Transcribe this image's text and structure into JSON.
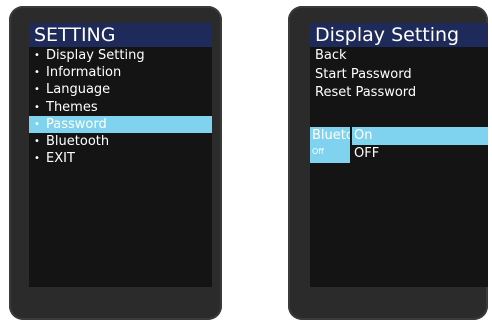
{
  "left_screen": {
    "title": "SETTING",
    "items": [
      {
        "label": "Display Setting"
      },
      {
        "label": "Information"
      },
      {
        "label": "Language"
      },
      {
        "label": "Themes"
      },
      {
        "label": "Password"
      },
      {
        "label": "Bluetooth"
      },
      {
        "label": "EXIT"
      }
    ],
    "selected_index": 4,
    "bullet": "•"
  },
  "right_screen": {
    "title": "Display Setting",
    "items": [
      {
        "label": "Back"
      },
      {
        "label": "Start Password"
      },
      {
        "label": "Reset Password"
      }
    ],
    "bluetooth": {
      "label": "Blueto",
      "state": "Off",
      "options": [
        {
          "label": "On"
        },
        {
          "label": "OFF"
        }
      ],
      "selected_option": 0
    }
  },
  "colors": {
    "title_bar": "#1e2a5a",
    "highlight": "#7fd3ee",
    "screen_bg": "#141414",
    "device_frame": "#2b2b2b"
  }
}
